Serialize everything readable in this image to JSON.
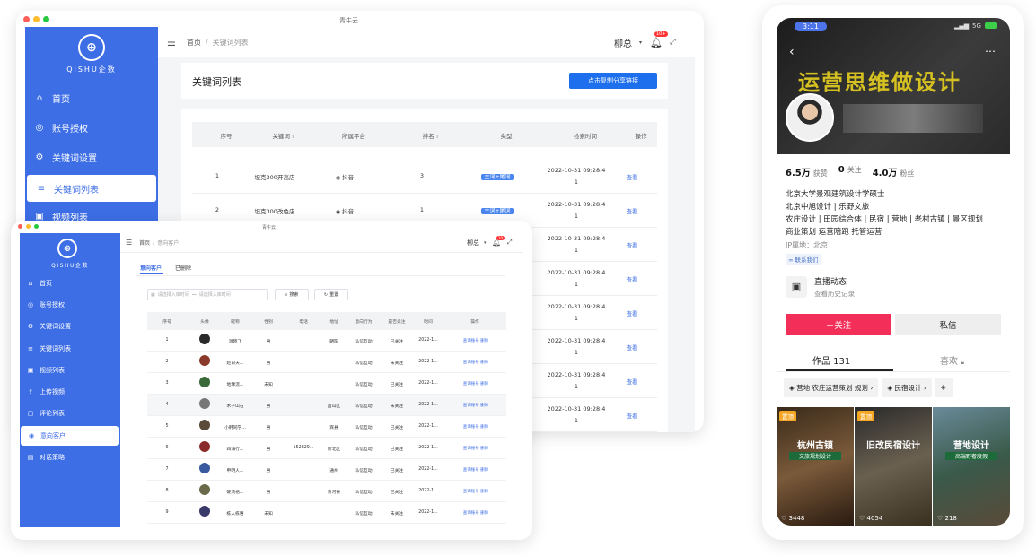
{
  "laptop": {
    "window_title": "青牛云",
    "logo_text": "QISHU企数",
    "menu": [
      {
        "icon": "home-icon",
        "glyph": "⌂",
        "label": "首页"
      },
      {
        "icon": "shield-icon",
        "glyph": "◎",
        "label": "账号授权"
      },
      {
        "icon": "gear-icon",
        "glyph": "⚙",
        "label": "关键词设置"
      },
      {
        "icon": "list-icon",
        "glyph": "≡",
        "label": "关键词列表"
      },
      {
        "icon": "video-icon",
        "glyph": "▣",
        "label": "视频列表"
      }
    ],
    "breadcrumb": {
      "home": "首页",
      "sep": "/",
      "current": "关键词列表"
    },
    "user": "柳总",
    "badge": "10+",
    "page_title": "关键词列表",
    "copy_button": "点击复制分享链接",
    "columns": [
      "序号",
      "关键词",
      "所属平台",
      "排名",
      "类型",
      "检索时间",
      "操作"
    ],
    "rows": [
      {
        "no": "1",
        "keyword": "坦克300开高店",
        "platform": "抖音",
        "rank": "3",
        "type": "主词+尾词",
        "time1": "2022-10-31 09:28:4",
        "time2": "1",
        "action": "查看"
      },
      {
        "no": "2",
        "keyword": "坦克300改色店",
        "platform": "抖音",
        "rank": "1",
        "type": "主词+尾词",
        "time1": "2022-10-31 09:28:4",
        "time2": "1",
        "action": "查看"
      },
      {
        "no": "",
        "keyword": "",
        "platform": "",
        "rank": "",
        "type": "",
        "time1": "2022-10-31 09:28:4",
        "time2": "1",
        "action": "查看"
      },
      {
        "no": "",
        "keyword": "",
        "platform": "",
        "rank": "",
        "type": "",
        "time1": "2022-10-31 09:28:4",
        "time2": "1",
        "action": "查看"
      },
      {
        "no": "",
        "keyword": "",
        "platform": "",
        "rank": "",
        "type": "",
        "time1": "2022-10-31 09:28:4",
        "time2": "1",
        "action": "查看"
      },
      {
        "no": "",
        "keyword": "",
        "platform": "",
        "rank": "",
        "type": "",
        "time1": "2022-10-31 09:28:4",
        "time2": "1",
        "action": "查看"
      },
      {
        "no": "",
        "keyword": "",
        "platform": "",
        "rank": "",
        "type": "",
        "time1": "2022-10-31 09:28:4",
        "time2": "1",
        "action": "查看"
      },
      {
        "no": "",
        "keyword": "",
        "platform": "",
        "rank": "",
        "type": "",
        "time1": "2022-10-31 09:28:4",
        "time2": "1",
        "action": "查看"
      }
    ]
  },
  "tablet": {
    "window_title": "青牛云",
    "logo_text": "QISHU企数",
    "menu": [
      {
        "icon": "home-icon",
        "glyph": "⌂",
        "label": "首页"
      },
      {
        "icon": "shield-icon",
        "glyph": "◎",
        "label": "账号授权"
      },
      {
        "icon": "gear-icon",
        "glyph": "⚙",
        "label": "关键词设置"
      },
      {
        "icon": "list-icon",
        "glyph": "≡",
        "label": "关键词列表"
      },
      {
        "icon": "video-icon",
        "glyph": "▣",
        "label": "视频列表"
      },
      {
        "icon": "upload-icon",
        "glyph": "⇪",
        "label": "上传视频"
      },
      {
        "icon": "comment-icon",
        "glyph": "▢",
        "label": "评论列表"
      },
      {
        "icon": "customer-icon",
        "glyph": "◉",
        "label": "意向客户"
      },
      {
        "icon": "chat-icon",
        "glyph": "▤",
        "label": "对话策略"
      }
    ],
    "breadcrumb": {
      "home": "首页",
      "sep": "/",
      "current": "意向客户"
    },
    "user": "柳总",
    "badge": "10",
    "tabs": [
      "意向客户",
      "已删除"
    ],
    "date_start_placeholder": "请选择入库时间",
    "date_sep": "—",
    "date_end_placeholder": "请选择入库时间",
    "search_button": "搜索",
    "reset_button": "重置",
    "columns": [
      "序号",
      "头像",
      "昵称",
      "性别",
      "电话",
      "地址",
      "意向行为",
      "是否关注",
      "时间",
      "操作"
    ],
    "rows": [
      {
        "no": "1",
        "nick": "温晓飞",
        "sex": "男",
        "phone": "",
        "addr": "朝阳",
        "intent": "私信互动",
        "follow": "已关注",
        "time": "2022-1...",
        "a1": "查询账号",
        "a2": "删除"
      },
      {
        "no": "2",
        "nick": "赵日天...",
        "sex": "男",
        "phone": "",
        "addr": "",
        "intent": "私信互动",
        "follow": "未关注",
        "time": "2022-1...",
        "a1": "查询账号",
        "a2": "删除"
      },
      {
        "no": "3",
        "nick": "地球流...",
        "sex": "未知",
        "phone": "",
        "addr": "",
        "intent": "私信互动",
        "follow": "已关注",
        "time": "2022-1...",
        "a1": "查询账号",
        "a2": "删除"
      },
      {
        "no": "4",
        "nick": "木子山石",
        "sex": "男",
        "phone": "",
        "addr": "昌山区",
        "intent": "私信互动",
        "follow": "未关注",
        "time": "2022-1...",
        "a1": "查询账号",
        "a2": "删除"
      },
      {
        "no": "5",
        "nick": "小韩同学...",
        "sex": "男",
        "phone": "",
        "addr": "宾县",
        "intent": "私信互动",
        "follow": "已关注",
        "time": "2022-1...",
        "a1": "查询账号",
        "a2": "删除"
      },
      {
        "no": "6",
        "nick": "四海行...",
        "sex": "男",
        "phone": "152829...",
        "addr": "新北区",
        "intent": "私信互动",
        "follow": "已关注",
        "time": "2022-1...",
        "a1": "查询账号",
        "a2": "删除"
      },
      {
        "no": "7",
        "nick": "申明人...",
        "sex": "男",
        "phone": "",
        "addr": "通州",
        "intent": "私信互动",
        "follow": "已关注",
        "time": "2022-1...",
        "a1": "查询账号",
        "a2": "删除"
      },
      {
        "no": "8",
        "nick": "硬浪格...",
        "sex": "男",
        "phone": "",
        "addr": "青河县",
        "intent": "私信互动",
        "follow": "已关注",
        "time": "2022-1...",
        "a1": "查询账号",
        "a2": "删除"
      },
      {
        "no": "9",
        "nick": "栋人栋语",
        "sex": "未知",
        "phone": "",
        "addr": "",
        "intent": "私信互动",
        "follow": "未关注",
        "time": "2022-1...",
        "a1": "查询账号",
        "a2": "删除"
      }
    ],
    "avatar_colors": [
      "#2a2a2a",
      "#8a3a2a",
      "#3a6a3a",
      "#777777",
      "#5a4a3a",
      "#8a2a2a",
      "#3a5aa0",
      "#6a6a4a",
      "#3a3a6a"
    ]
  },
  "phone": {
    "time": "3:11",
    "network": "5G",
    "banner_text": "运营思维做设计",
    "stats": [
      {
        "num": "6.5万",
        "label": "获赞"
      },
      {
        "num": "0",
        "label": "关注"
      },
      {
        "num": "4.0万",
        "label": "粉丝"
      }
    ],
    "bio": [
      "北京大学景观建筑设计学硕士",
      "北京中旭设计 | 乐野文旅",
      "农庄设计 | 田园综合体 | 民宿 | 营地 | 老村古镇 | 景区规划",
      "商业策划  运营陪跑  托管运营"
    ],
    "ip": "IP属地：北京",
    "contact": "联系我们",
    "live_title": "直播动态",
    "live_sub": "查看历史记录",
    "follow_button": "＋关注",
    "message_button": "私信",
    "tab_works": "作品 131",
    "tab_likes": "喜欢",
    "chips": [
      "营地 农庄运营策划 规划",
      "民宿设计"
    ],
    "videos": [
      {
        "tag": "置顶",
        "title": "杭州古镇",
        "sub": "文旅规划设计",
        "likes": "3448"
      },
      {
        "tag": "置顶",
        "title": "旧改民宿设计",
        "sub": "",
        "likes": "4054"
      },
      {
        "tag": "",
        "title": "营地设计",
        "sub": "高端野奢度假",
        "likes": "218"
      }
    ]
  }
}
